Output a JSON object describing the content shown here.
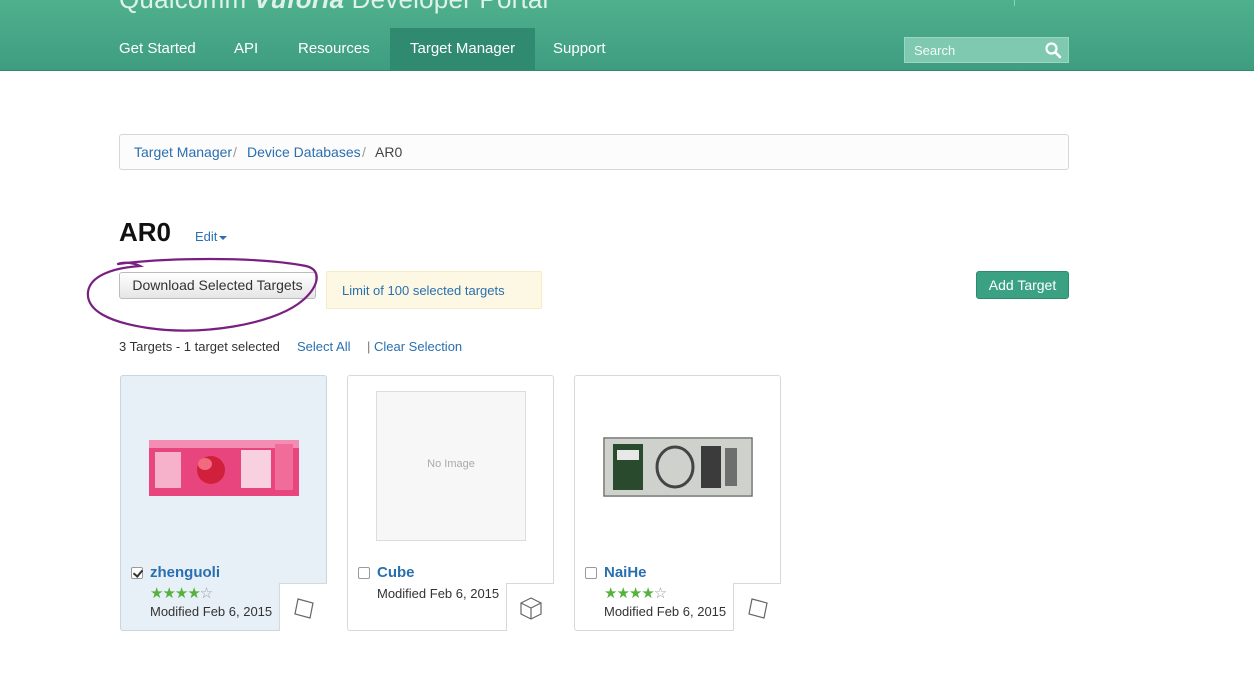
{
  "header": {
    "brand_part1": "Qualcomm",
    "brand_part2": "Vuforia",
    "brand_part3": "Developer Portal",
    "nav": [
      {
        "label": "Get Started"
      },
      {
        "label": "API"
      },
      {
        "label": "Resources"
      },
      {
        "label": "Target Manager",
        "active": true
      },
      {
        "label": "Support"
      }
    ],
    "search": {
      "placeholder": "Search",
      "icon": "search-icon"
    }
  },
  "breadcrumb": {
    "items": [
      "Target Manager",
      "Device Databases",
      "AR0"
    ],
    "separator": "/"
  },
  "database": {
    "title": "AR0",
    "edit_label": "Edit"
  },
  "actions": {
    "download_label": "Download Selected Targets",
    "limit_note": "Limit of 100 selected targets",
    "add_label": "Add Target"
  },
  "summary": {
    "count_text": "3 Targets - 1 target selected",
    "select_all": "Select All",
    "pipe": "|",
    "clear_selection": "Clear Selection"
  },
  "targets": [
    {
      "name": "zhenguoli",
      "selected": true,
      "rating": 4,
      "max_rating": 5,
      "modified": "Modified Feb 6, 2015",
      "type_icon": "image-target-icon",
      "image": "strawberry-milk-package"
    },
    {
      "name": "Cube",
      "selected": false,
      "rating": null,
      "modified": "Modified Feb 6, 2015",
      "type_icon": "cube-target-icon",
      "image_placeholder": "No Image"
    },
    {
      "name": "NaiHe",
      "selected": false,
      "rating": 4,
      "max_rating": 5,
      "modified": "Modified Feb 6, 2015",
      "type_icon": "image-target-icon",
      "image": "milk-carton-package"
    }
  ],
  "colors": {
    "header": "#45a585",
    "nav_active": "#2f8a70",
    "link": "#2a6fb0",
    "add_button": "#3aa283",
    "star": "#56b13f",
    "annotation": "#7a1f82",
    "note_bg": "#fcf8e3"
  }
}
